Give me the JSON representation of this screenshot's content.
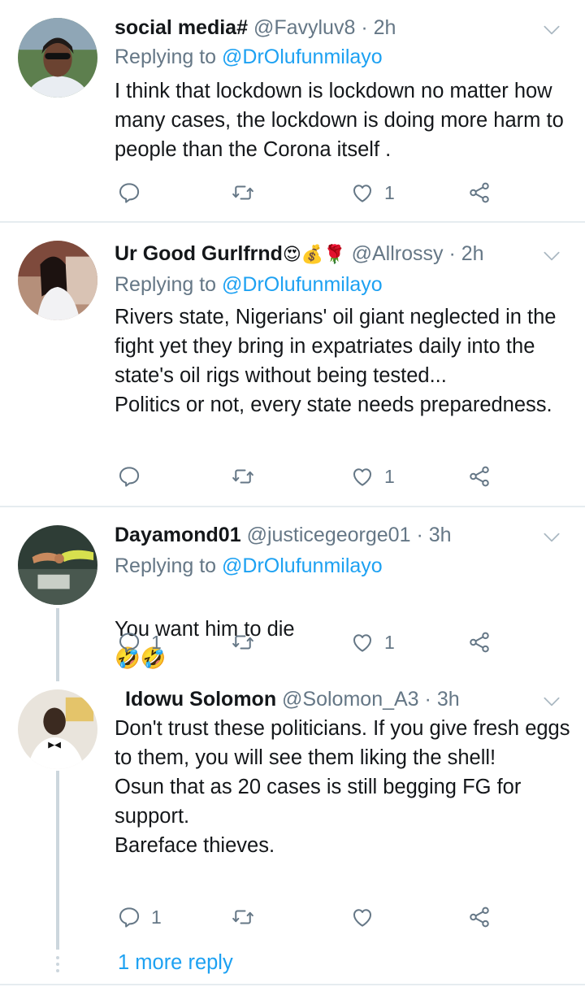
{
  "tweets": [
    {
      "name": "social media#",
      "name_emoji": "",
      "handle": "@Favyluv8",
      "time": "2h",
      "replying_prefix": "Replying to",
      "replying_to": "@DrOlufunmilayo",
      "text": "I think that lockdown is lockdown no matter how many cases, the lockdown is doing more harm to people than the Corona itself .",
      "reply_count": "",
      "like_count": "1"
    },
    {
      "name": "Ur Good Gurlfrnd",
      "name_emoji": "😍💰🌹",
      "handle": "@Allrossy",
      "time": "2h",
      "replying_prefix": "Replying to",
      "replying_to": "@DrOlufunmilayo",
      "text": "Rivers state, Nigerians' oil giant  neglected in the fight yet they bring in expatriates daily into the state's oil rigs without being tested...\nPolitics or not, every state needs preparedness.",
      "reply_count": "",
      "like_count": "1"
    },
    {
      "name": "Dayamond01",
      "name_emoji": "",
      "handle": "@justicegeorge01",
      "time": "3h",
      "replying_prefix": "Replying to",
      "replying_to": "@DrOlufunmilayo",
      "text": "You want him to die",
      "text_emoji": "🤣🤣",
      "reply_count": "1",
      "like_count": "1"
    },
    {
      "name": "Idowu Solomon",
      "name_emoji": "",
      "handle": "@Solomon_A3",
      "time": "3h",
      "text": "Don't trust these politicians. If you give fresh eggs to them, you will see them liking the shell!\nOsun that as 20 cases is still begging FG for support.\nBareface thieves.",
      "reply_count": "1",
      "like_count": ""
    }
  ],
  "more_replies": "1 more reply",
  "separator": "·",
  "colors": {
    "text": "#14171a",
    "muted": "#657786",
    "link": "#1da1f2",
    "divider": "#e6ecf0",
    "thread_line": "#ccd6dd"
  },
  "icons": [
    "reply-icon",
    "retweet-icon",
    "like-icon",
    "share-icon",
    "chevron-down-icon"
  ]
}
